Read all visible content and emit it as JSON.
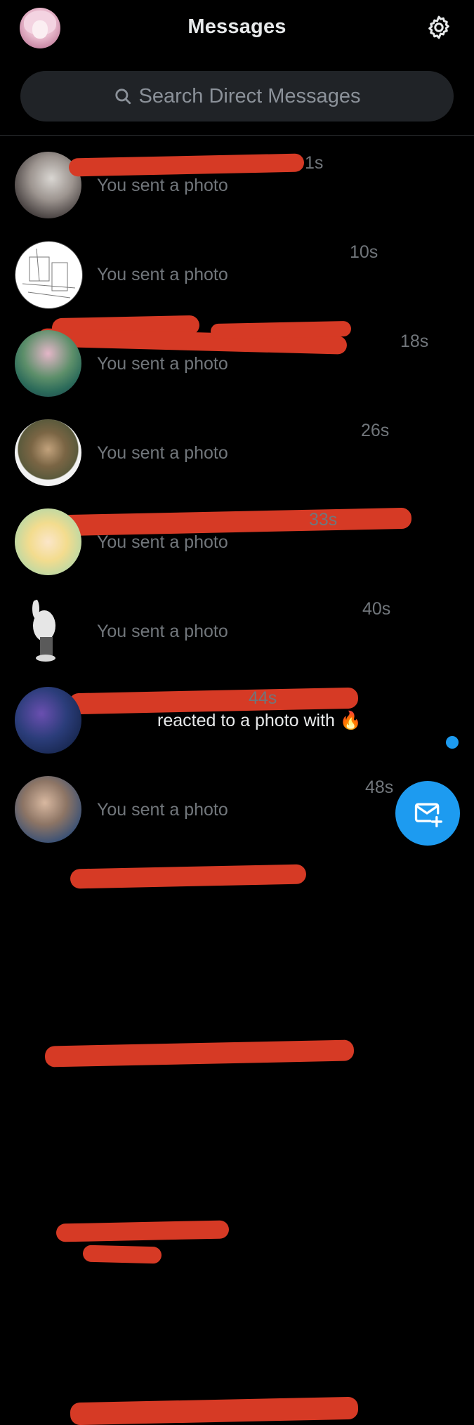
{
  "header": {
    "title": "Messages",
    "avatar_icon": "user-avatar",
    "settings_icon": "gear-icon"
  },
  "search": {
    "placeholder": "Search Direct Messages",
    "icon": "search-icon"
  },
  "conversations": [
    {
      "time": "1s",
      "preview": "You sent a photo",
      "unread": false,
      "avatar_colors": [
        "#d9d6d2",
        "#3a3434"
      ]
    },
    {
      "time": "10s",
      "preview": "You sent a photo",
      "unread": false,
      "avatar_colors": [
        "#ffffff",
        "#8a8a8a"
      ]
    },
    {
      "time": "18s",
      "preview": "You sent a photo",
      "unread": false,
      "avatar_colors": [
        "#2c6b5a",
        "#e4b6c8"
      ]
    },
    {
      "time": "26s",
      "preview": "You sent a photo",
      "unread": false,
      "avatar_colors": [
        "#f2f2f2",
        "#5b5a3c"
      ]
    },
    {
      "time": "33s",
      "preview": "You sent a photo",
      "unread": false,
      "avatar_colors": [
        "#bcd8a4",
        "#f3dc8e"
      ]
    },
    {
      "time": "40s",
      "preview": "You sent a photo",
      "unread": false,
      "avatar_colors": [
        "#000000",
        "#e6e6e6"
      ]
    },
    {
      "time": "44s",
      "preview": "reacted to a photo with 🔥",
      "unread": true,
      "avatar_colors": [
        "#1a2a55",
        "#6a4fb0"
      ]
    },
    {
      "time": "48s",
      "preview": "You sent a photo",
      "unread": false,
      "avatar_colors": [
        "#8d7565",
        "#2f4c78"
      ]
    }
  ],
  "new_message_button": {
    "icon": "new-message-icon"
  },
  "colors": {
    "background": "#000000",
    "accent": "#1d9bf0",
    "secondary_text": "#71767b",
    "redaction": "#d63a25"
  }
}
